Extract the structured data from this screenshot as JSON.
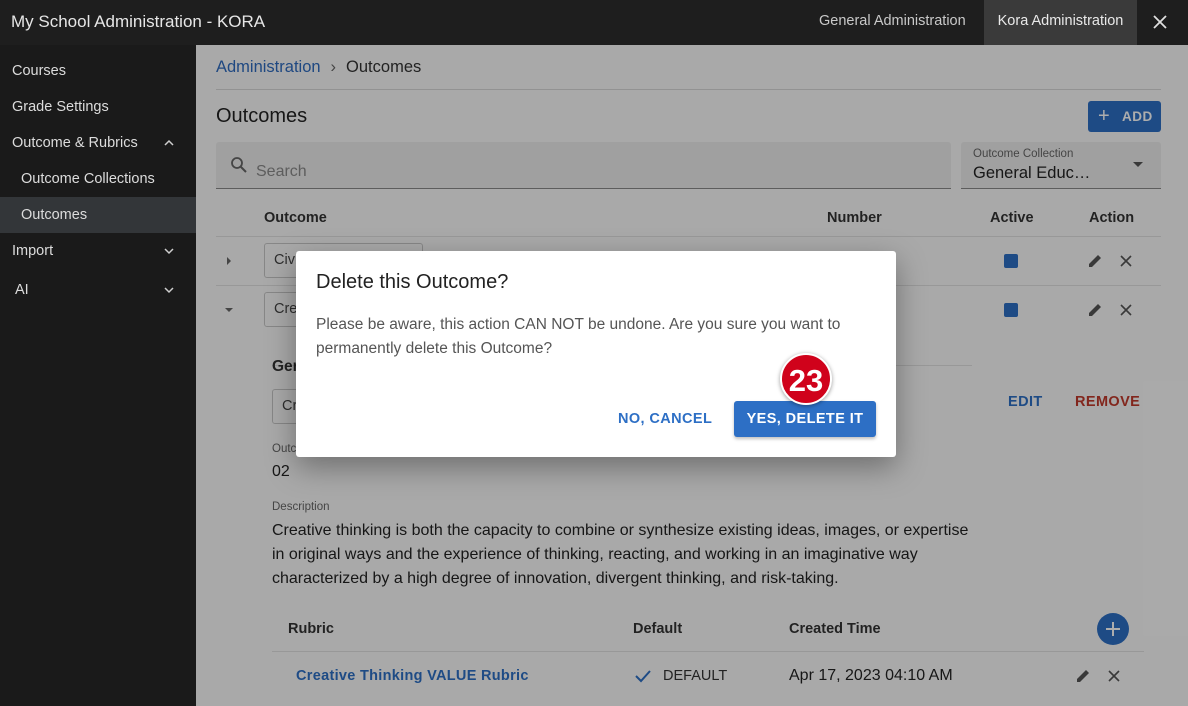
{
  "app": {
    "title": "My School Administration - KORA",
    "tabs": [
      "General Administration",
      "Kora Administration"
    ],
    "active_tab": "Kora Administration"
  },
  "sidebar": {
    "items": [
      {
        "label": "Courses"
      },
      {
        "label": "Grade Settings"
      },
      {
        "label": "Outcome & Rubrics",
        "expanded": true
      },
      {
        "label": "Outcome Collections"
      },
      {
        "label": "Outcomes",
        "active": true
      },
      {
        "label": "Import"
      },
      {
        "label": "AI"
      }
    ]
  },
  "breadcrumb": {
    "root": "Administration",
    "separator": "›",
    "current": "Outcomes"
  },
  "page": {
    "title": "Outcomes",
    "add_label": "ADD",
    "search_placeholder": "Search",
    "collection_label": "Outcome Collection",
    "collection_value": "General Educ…"
  },
  "table": {
    "headers": {
      "outcome": "Outcome",
      "number": "Number",
      "active": "Active",
      "action": "Action"
    },
    "rows": [
      {
        "name": "Civi",
        "active": true
      },
      {
        "name": "Cre",
        "active": true
      }
    ]
  },
  "detail": {
    "section_label": "Ger",
    "name_box": "Cr",
    "edit_label": "EDIT",
    "remove_label": "REMOVE",
    "number_label": "Outc",
    "number_value": "02",
    "description_label": "Description",
    "description": "Creative thinking is both the capacity to combine or synthesize existing ideas, images, or expertise in original ways and the experience of thinking, reacting, and working in an imaginative way characterized by a high degree of innovation, divergent thinking, and risk-taking."
  },
  "rubrics": {
    "headers": {
      "rubric": "Rubric",
      "default": "Default",
      "created": "Created Time"
    },
    "rows": [
      {
        "name": "Creative Thinking VALUE Rubric",
        "default": "DEFAULT",
        "created": "Apr 17, 2023 04:10 AM"
      }
    ]
  },
  "dialog": {
    "title": "Delete this Outcome?",
    "message": "Please be aware, this action CAN NOT be undone. Are you sure you want to permanently delete this Outcome?",
    "cancel_label": "NO, CANCEL",
    "confirm_label": "YES, DELETE IT"
  },
  "step_badge": "23",
  "colors": {
    "accent": "#2d6fc5",
    "danger": "#c0392b",
    "badge": "#d0021b",
    "topbar": "#1e1e1e",
    "sidebar": "#1a1a1a"
  }
}
